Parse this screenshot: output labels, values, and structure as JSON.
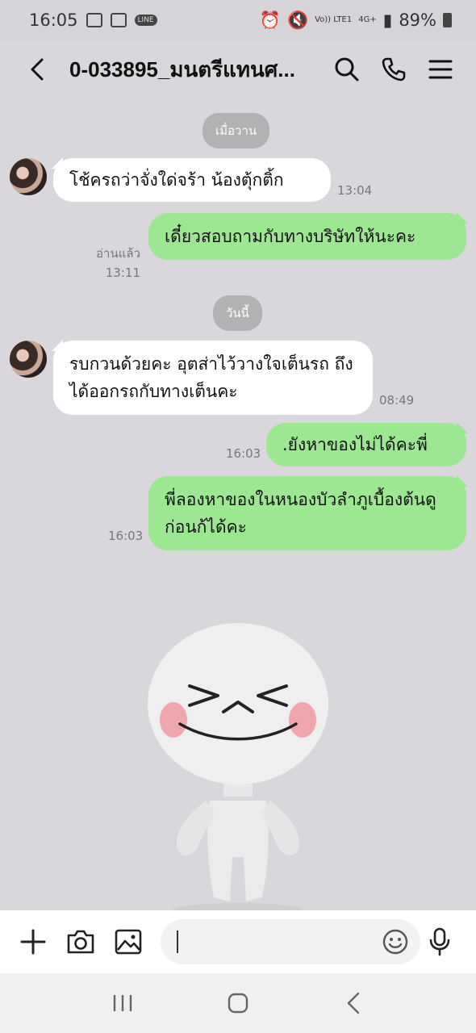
{
  "status_bar": {
    "time": "16:05",
    "volte_label": "Vo)) LTE1",
    "network_label": "4G+",
    "battery": "89%"
  },
  "header": {
    "title": "0-033895_มนตรีแทนศ..."
  },
  "chat": {
    "date_yesterday": "เมื่อวาน",
    "date_today": "วันนี้",
    "messages": [
      {
        "direction": "in",
        "text": "โช้ครถว่าจั่งใด่จร้า น้องตุ้กติ้ก",
        "time": "13:04"
      },
      {
        "direction": "out",
        "text": "เดี๋ยวสอบถามกับทางบริษัทให้นะคะ",
        "time": "13:11",
        "read_label": "อ่านแล้ว"
      },
      {
        "direction": "in",
        "text": "รบกวนด้วยคะ อุตส่าไว้วางใจเต็นรถ ถึงได้ออกรถกับทางเต็นคะ",
        "time": "08:49"
      },
      {
        "direction": "out",
        "text": ".ยังหาของไม่ได้คะพี่",
        "time": "16:03"
      },
      {
        "direction": "out",
        "text": "พี่ลองหาของในหนองบัวลำภูเบื้องต้นดูก่อนก้ได้คะ",
        "time": "16:03"
      }
    ]
  },
  "input": {
    "value": "",
    "placeholder": ""
  },
  "colors": {
    "outgoing_bubble": "#9de692",
    "incoming_bubble": "#ffffff",
    "background": "#d9d7dc"
  }
}
